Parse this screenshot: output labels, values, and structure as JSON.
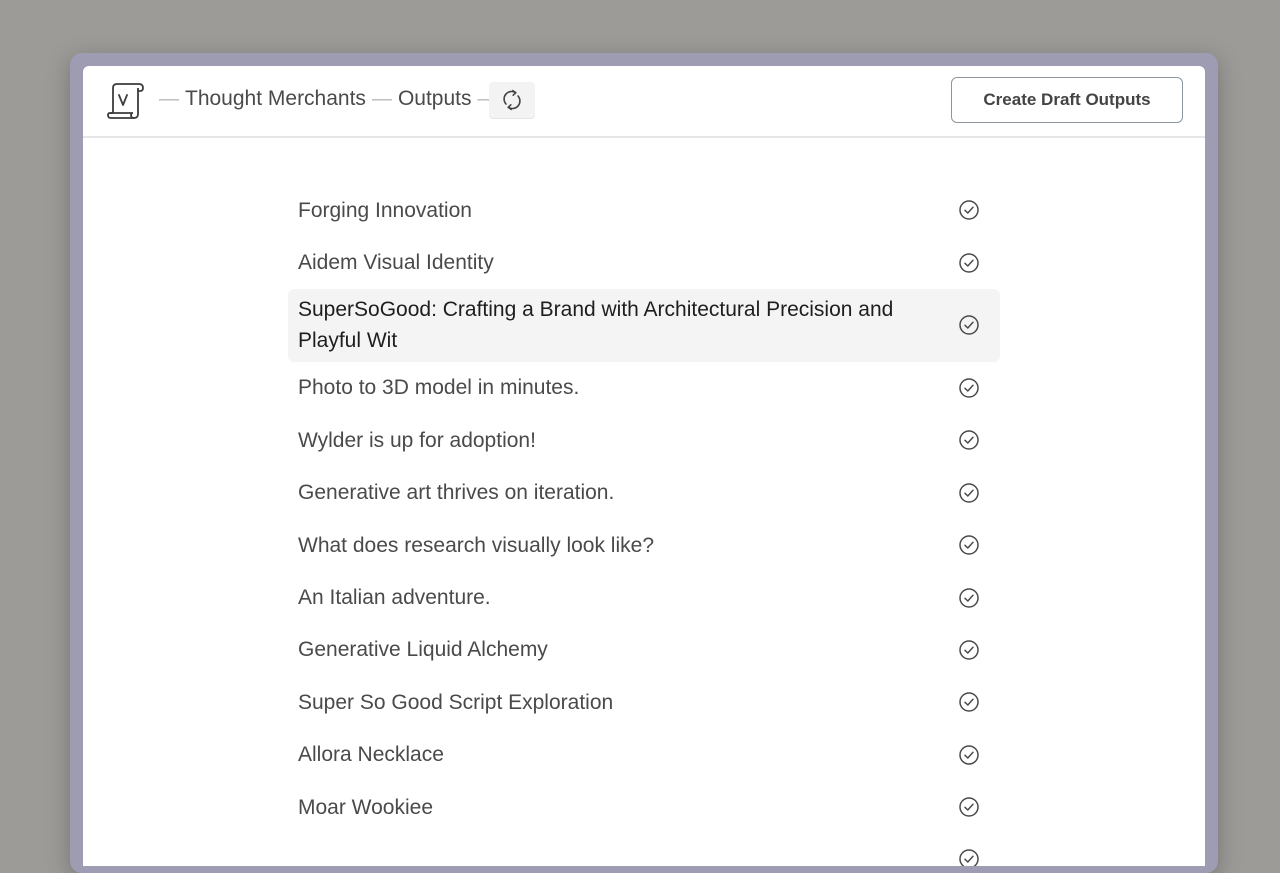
{
  "breadcrumb": {
    "separator": "—",
    "workspace": "Thought Merchants",
    "section": "Outputs"
  },
  "header": {
    "create_button_label": "Create Draft Outputs"
  },
  "icons": {
    "logo": "scroll-v-logo-icon",
    "refresh": "refresh-icon",
    "status": "check-circle-icon"
  },
  "outputs": [
    {
      "title": "Forging Innovation"
    },
    {
      "title": "Aidem Visual Identity"
    },
    {
      "title": "SuperSoGood: Crafting a Brand with Architectural Precision and Playful Wit",
      "selected": true
    },
    {
      "title": "Photo to 3D model in minutes."
    },
    {
      "title": "Wylder is up for adoption!"
    },
    {
      "title": "Generative art thrives on iteration."
    },
    {
      "title": "What does research visually look like?"
    },
    {
      "title": "An Italian adventure."
    },
    {
      "title": "Generative Liquid Alchemy"
    },
    {
      "title": "Super So Good Script Exploration"
    },
    {
      "title": "Allora Necklace"
    },
    {
      "title": "Moar Wookiee"
    },
    {
      "title": ""
    }
  ]
}
